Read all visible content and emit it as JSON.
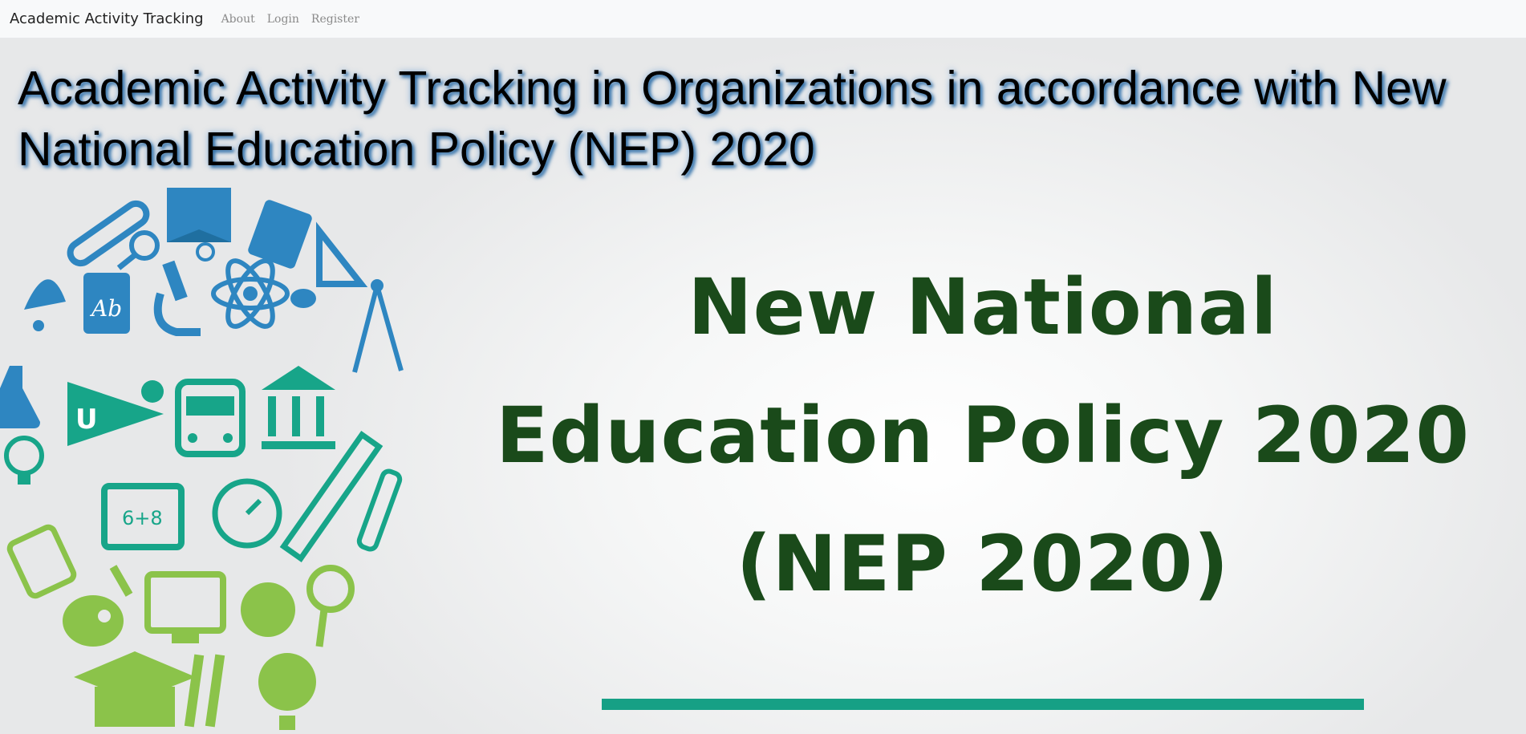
{
  "navbar": {
    "brand": "Academic Activity Tracking",
    "links": [
      "About",
      "Login",
      "Register"
    ]
  },
  "main": {
    "heading": "Academic Activity Tracking in Organizations in accordance with New National Education Policy (NEP) 2020"
  },
  "hero_image": {
    "lines": [
      "New National",
      "Education Policy 2020",
      "(NEP 2020)"
    ],
    "text_color": "#1a4a1a",
    "rule_color": "#16a085",
    "icon_colors": [
      "#2e86c1",
      "#17a589",
      "#8bc34a"
    ]
  }
}
